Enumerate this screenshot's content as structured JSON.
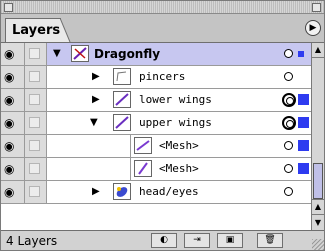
{
  "window": {
    "tab_label": "Layers",
    "menu_icon": "triangle-right-icon"
  },
  "icons": {
    "eye": "eye-icon",
    "expand_open": "triangle-down-icon",
    "expand_closed": "triangle-right-icon",
    "selection_color": "#2e3bf0",
    "selected_row_color": "#c7c7f0"
  },
  "rows": [
    {
      "label": "Dragonfly",
      "expanded": true,
      "selected": true,
      "target": "single",
      "selection": "small"
    },
    {
      "label": "pincers",
      "expanded": false,
      "target": "single",
      "selection": "none"
    },
    {
      "label": "lower wings",
      "expanded": false,
      "target": "double",
      "selection": "square"
    },
    {
      "label": "upper wings",
      "expanded": true,
      "target": "double",
      "selection": "square"
    },
    {
      "label": "<Mesh>",
      "target": "single",
      "selection": "square"
    },
    {
      "label": "<Mesh>",
      "target": "single",
      "selection": "square"
    },
    {
      "label": "head/eyes",
      "expanded": false,
      "target": "single",
      "selection": "none"
    }
  ],
  "status": {
    "layer_count": "4 Layers"
  },
  "footer_buttons": [
    "make-clipping-mask-icon",
    "new-sublayer-icon",
    "new-layer-icon",
    "trash-icon"
  ]
}
